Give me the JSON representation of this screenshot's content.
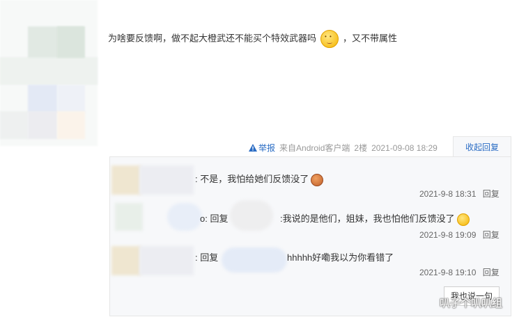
{
  "post": {
    "text_before_emoji": "为啥要反馈啊，做不起大橙武还不能买个特效武器吗",
    "text_after_emoji": "，又不带属性",
    "meta": {
      "report_label": "举报",
      "source": "来自Android客户端",
      "floor": "2楼",
      "timestamp": "2021-09-08 18:29"
    },
    "collapse_label": "收起回复"
  },
  "replies": [
    {
      "text": ": 不是，我怕给她们反馈没了",
      "timestamp": "2021-9-8 18:31",
      "reply_label": "回复"
    },
    {
      "text_a": "o: 回复",
      "text_b": ":我说的是他们，姐妹，我也怕他们反馈没了",
      "timestamp": "2021-9-8 19:09",
      "reply_label": "回复"
    },
    {
      "text_a": ": 回复",
      "text_b": "hhhhh好嘞我以为你看错了",
      "timestamp": "2021-9-8 19:10",
      "reply_label": "回复"
    }
  ],
  "say_button_label": "我也说一句",
  "watermark": "叭子个叭叭组",
  "colors": {
    "link": "#2a6cc4",
    "reply_bg": "#f7f8fa",
    "border": "#e6e6e6"
  }
}
